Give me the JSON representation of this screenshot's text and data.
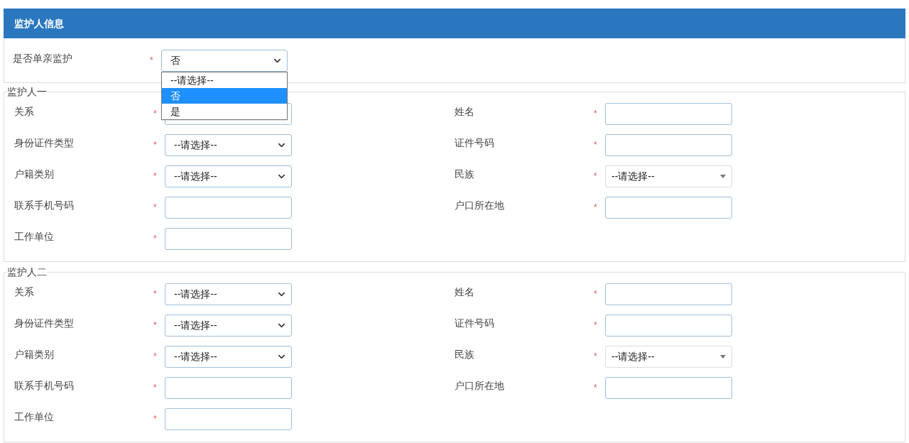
{
  "header": {
    "title": "监护人信息"
  },
  "single_parent": {
    "label": "是否单亲监护",
    "marker": "*",
    "value": "否",
    "expanded": true,
    "options": [
      {
        "label": "--请选择--",
        "selected": false
      },
      {
        "label": "否",
        "selected": true
      },
      {
        "label": "是",
        "selected": false
      }
    ]
  },
  "guardians": [
    {
      "legend": "监护人一",
      "fields": [
        {
          "label": "关系",
          "marker": "*",
          "kind": "select"
        },
        {
          "label": "姓名",
          "marker": "*",
          "kind": "input"
        },
        {
          "label": "身份证件类型",
          "marker": "*",
          "kind": "select",
          "value": "--请选择--"
        },
        {
          "label": "证件号码",
          "marker": "*",
          "kind": "input"
        },
        {
          "label": "户籍类别",
          "marker": "*",
          "kind": "select",
          "value": "--请选择--"
        },
        {
          "label": "民族",
          "marker": "*",
          "kind": "combo",
          "value": "--请选择--"
        },
        {
          "label": "联系手机号码",
          "marker": "*",
          "kind": "input"
        },
        {
          "label": "户口所在地",
          "marker": "*",
          "kind": "input"
        },
        {
          "label": "工作单位",
          "marker": "*",
          "kind": "input"
        }
      ]
    },
    {
      "legend": "监护人二",
      "fields": [
        {
          "label": "关系",
          "marker": "*",
          "kind": "select",
          "value": "--请选择--"
        },
        {
          "label": "姓名",
          "marker": "*",
          "kind": "input"
        },
        {
          "label": "身份证件类型",
          "marker": "*",
          "kind": "select",
          "value": "--请选择--"
        },
        {
          "label": "证件号码",
          "marker": "*",
          "kind": "input"
        },
        {
          "label": "户籍类别",
          "marker": "*",
          "kind": "select",
          "value": "--请选择--"
        },
        {
          "label": "民族",
          "marker": "*",
          "kind": "combo",
          "value": "--请选择--"
        },
        {
          "label": "联系手机号码",
          "marker": "*",
          "kind": "input"
        },
        {
          "label": "户口所在地",
          "marker": "*",
          "kind": "input"
        },
        {
          "label": "工作单位",
          "marker": "*",
          "kind": "input"
        }
      ]
    }
  ]
}
